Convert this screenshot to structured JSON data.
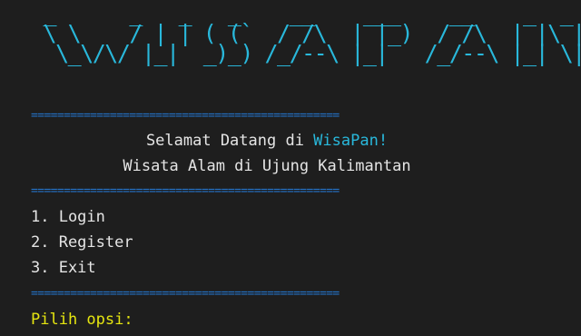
{
  "banner": {
    "ascii_art": " _      _   _   _    __    ___    __    _  _\n \\ \\    / | | ( (`  / /\\  | |_)  / /\\  | |\\ |\n  \\_\\/\\/ |_|  _)_) /_/--\\ |_|   /_/--\\ |_| \\|",
    "name": "WISAPAN"
  },
  "separator": "===============================================",
  "welcome": {
    "prefix": "Selamat Datang di ",
    "app_name": "WisaPan!",
    "tagline": "Wisata Alam di Ujung Kalimantan"
  },
  "menu": {
    "items": [
      {
        "label": "1. Login"
      },
      {
        "label": "2. Register"
      },
      {
        "label": "3. Exit"
      }
    ],
    "prompt": "Pilih opsi:"
  },
  "colors": {
    "background": "#1e1e1e",
    "text": "#e5e5e5",
    "banner": "#29b8db",
    "separator": "#2472c8",
    "prompt": "#e5e510"
  }
}
